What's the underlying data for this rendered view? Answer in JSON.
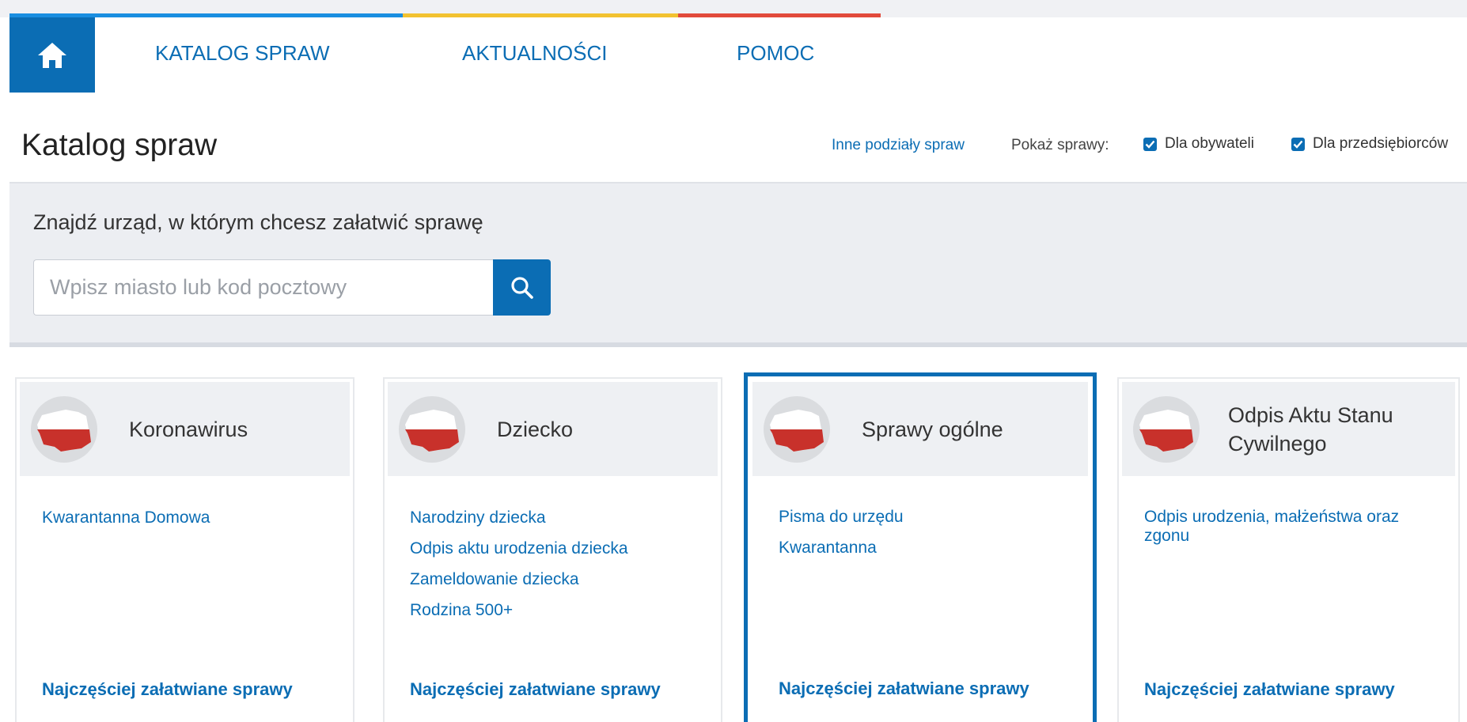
{
  "colors": {
    "brand_blue": "#0b6db4",
    "stripe_blue": "#1a8ee0",
    "stripe_yellow": "#f2c230",
    "stripe_red": "#e24a3b",
    "flag_red": "#c8312b"
  },
  "nav": {
    "home_icon": "home-icon",
    "items": [
      {
        "label": "KATALOG SPRAW"
      },
      {
        "label": "AKTUALNOŚCI"
      },
      {
        "label": "POMOC"
      }
    ]
  },
  "header": {
    "title": "Katalog spraw",
    "other_divisions_link": "Inne podziały spraw",
    "show_label": "Pokaż sprawy:",
    "filters": [
      {
        "label": "Dla obywateli",
        "checked": true
      },
      {
        "label": "Dla przedsiębiorców",
        "checked": true
      }
    ]
  },
  "search": {
    "label": "Znajdź urząd, w którym chcesz załatwić sprawę",
    "placeholder": "Wpisz miasto lub kod pocztowy",
    "value": "",
    "button_icon": "search-icon"
  },
  "cards": [
    {
      "title": "Koronawirus",
      "icon": "poland-map-icon",
      "links": [
        "Kwarantanna Domowa"
      ],
      "footer": "Najczęściej załatwiane sprawy"
    },
    {
      "title": "Dziecko",
      "icon": "poland-map-icon",
      "links": [
        "Narodziny dziecka",
        "Odpis aktu urodzenia dziecka",
        "Zameldowanie dziecka",
        "Rodzina 500+"
      ],
      "footer": "Najczęściej załatwiane sprawy"
    },
    {
      "title": "Sprawy ogólne",
      "icon": "poland-map-icon",
      "links": [
        "Pisma do urzędu",
        "Kwarantanna"
      ],
      "footer": "Najczęściej załatwiane sprawy",
      "active": true
    },
    {
      "title": "Odpis Aktu Stanu Cywilnego",
      "icon": "poland-map-icon",
      "links": [
        "Odpis urodzenia, małżeństwa oraz zgonu"
      ],
      "footer": "Najczęściej załatwiane sprawy"
    }
  ]
}
